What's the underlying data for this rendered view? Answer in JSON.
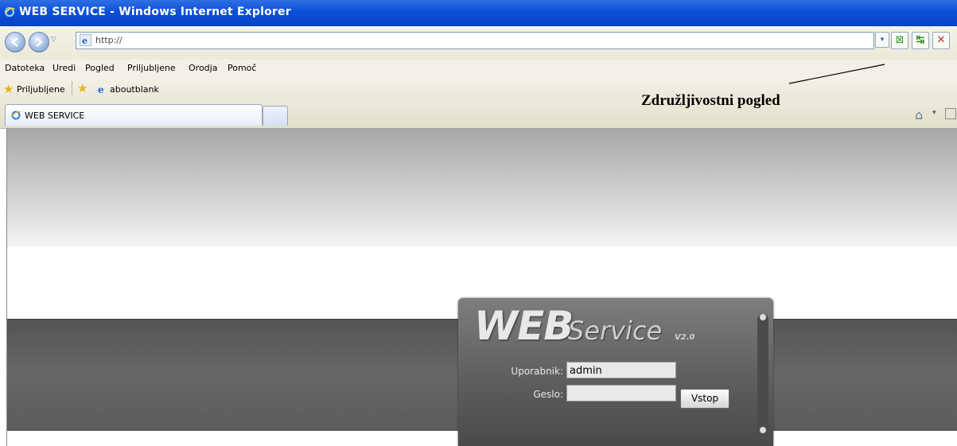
{
  "window": {
    "title": "WEB SERVICE - Windows Internet Explorer"
  },
  "address": {
    "url": "http://"
  },
  "menu": {
    "items": [
      "Datoteka",
      "Uredi",
      "Pogled",
      "Priljubljene",
      "Orodja",
      "Pomoč"
    ]
  },
  "favorites": {
    "label": "Priljubljene",
    "link": "aboutblank"
  },
  "tabs": [
    {
      "label": "WEB SERVICE"
    }
  ],
  "annotation": {
    "text": "Združljivostni pogled"
  },
  "login": {
    "logo_web": "WEB",
    "logo_service": "Service",
    "logo_version": "V2.0",
    "username_label": "Uporabnik:",
    "username_value": "admin",
    "password_label": "Geslo:",
    "password_value": "",
    "submit_label": "Vstop"
  },
  "colors": {
    "titlebar": "#0a4fd8",
    "panel": "#5e5e5e",
    "band": "#5b5b5b"
  }
}
